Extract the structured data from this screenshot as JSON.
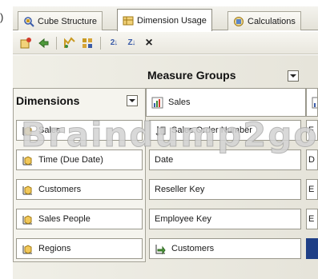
{
  "edge_mark": ")",
  "tabs": [
    {
      "label": "Cube Structure",
      "icon": "cube-structure-icon",
      "active": false
    },
    {
      "label": "Dimension Usage",
      "icon": "dimension-usage-icon",
      "active": true
    },
    {
      "label": "Calculations",
      "icon": "calculations-icon",
      "active": false
    }
  ],
  "toolbar": {
    "items": [
      "add-cube-dimension-icon",
      "delete-icon",
      "add-dimension-icon",
      "properties-icon",
      "sort-ascending-icon",
      "sort-descending-icon",
      "delete-x-icon"
    ],
    "sort_asc_glyph": "2↓",
    "sort_desc_glyph": "Z↓",
    "close_glyph": "×"
  },
  "grid": {
    "measure_groups_label": "Measure Groups",
    "dimensions_label": "Dimensions",
    "measure_group_columns": [
      {
        "label": "Sales",
        "icon": "measure-group-icon"
      }
    ],
    "rows": [
      {
        "dimension": "Sales",
        "usage": "Sales Order Number",
        "usage_icon": "fact-key-icon",
        "partial_next": "F"
      },
      {
        "dimension": "Time (Due Date)",
        "usage": "Date",
        "usage_icon": "",
        "partial_next": "D"
      },
      {
        "dimension": "Customers",
        "usage": "Reseller Key",
        "usage_icon": "",
        "partial_next": "E"
      },
      {
        "dimension": "Sales People",
        "usage": "Employee Key",
        "usage_icon": "",
        "partial_next": "E"
      },
      {
        "dimension": "Regions",
        "usage": "Customers",
        "usage_icon": "referenced-dimension-icon",
        "partial_next": ""
      }
    ]
  },
  "watermark": "Braindump2go",
  "colors": {
    "selection": "#1f3f86",
    "icon_gold": "#c99a22",
    "icon_blue": "#3b5ca8"
  }
}
